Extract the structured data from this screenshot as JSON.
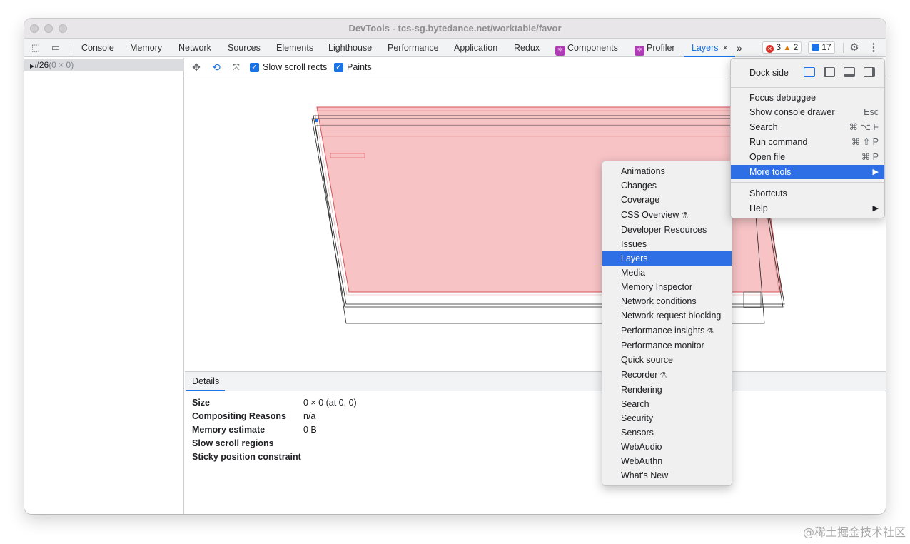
{
  "window": {
    "title": "DevTools - tcs-sg.bytedance.net/worktable/favor"
  },
  "tabs": [
    {
      "label": "Console"
    },
    {
      "label": "Memory"
    },
    {
      "label": "Network"
    },
    {
      "label": "Sources"
    },
    {
      "label": "Elements"
    },
    {
      "label": "Lighthouse"
    },
    {
      "label": "Performance"
    },
    {
      "label": "Application"
    },
    {
      "label": "Redux"
    },
    {
      "label": "Components"
    },
    {
      "label": "Profiler"
    },
    {
      "label": "Layers",
      "close": "×"
    }
  ],
  "tab_overflow": "»",
  "status": {
    "errors": "3",
    "warnings": "2",
    "messages": "17"
  },
  "tree": {
    "node": "#26",
    "size": "(0 × 0)"
  },
  "layers_toolbar": {
    "slow_scroll_label": "Slow scroll rects",
    "paints_label": "Paints",
    "slow_scroll_checked": true,
    "paints_checked": true
  },
  "details": {
    "tab": "Details",
    "rows": [
      {
        "label": "Size",
        "value": "0 × 0 (at 0, 0)"
      },
      {
        "label": "Compositing Reasons",
        "value": "n/a"
      },
      {
        "label": "Memory estimate",
        "value": "0 B"
      },
      {
        "label": "Slow scroll regions",
        "value": ""
      },
      {
        "label": "Sticky position constraint",
        "value": ""
      }
    ]
  },
  "main_menu": {
    "dock_side_label": "Dock side",
    "items": [
      {
        "label": "Focus debuggee",
        "shortcut": ""
      },
      {
        "label": "Show console drawer",
        "shortcut": "Esc"
      },
      {
        "label": "Search",
        "shortcut": "⌘ ⌥ F"
      },
      {
        "label": "Run command",
        "shortcut": "⌘ ⇧ P"
      },
      {
        "label": "Open file",
        "shortcut": "⌘ P"
      },
      {
        "label": "More tools",
        "shortcut": "▶"
      },
      {
        "label": "Shortcuts",
        "shortcut": ""
      },
      {
        "label": "Help",
        "shortcut": "▶"
      }
    ]
  },
  "more_tools_menu": {
    "items": [
      {
        "label": "Animations"
      },
      {
        "label": "Changes"
      },
      {
        "label": "Coverage"
      },
      {
        "label": "CSS Overview"
      },
      {
        "label": "Developer Resources"
      },
      {
        "label": "Issues"
      },
      {
        "label": "Layers"
      },
      {
        "label": "Media"
      },
      {
        "label": "Memory Inspector"
      },
      {
        "label": "Network conditions"
      },
      {
        "label": "Network request blocking"
      },
      {
        "label": "Performance insights"
      },
      {
        "label": "Performance monitor"
      },
      {
        "label": "Quick source"
      },
      {
        "label": "Recorder"
      },
      {
        "label": "Rendering"
      },
      {
        "label": "Search"
      },
      {
        "label": "Security"
      },
      {
        "label": "Sensors"
      },
      {
        "label": "WebAudio"
      },
      {
        "label": "WebAuthn"
      },
      {
        "label": "What's New"
      }
    ]
  },
  "colors": {
    "accent": "#1a73e8",
    "menu_highlight": "#2f6fe6",
    "layer_fill": "#f4a0a4"
  },
  "watermark": "@稀土掘金技术社区"
}
